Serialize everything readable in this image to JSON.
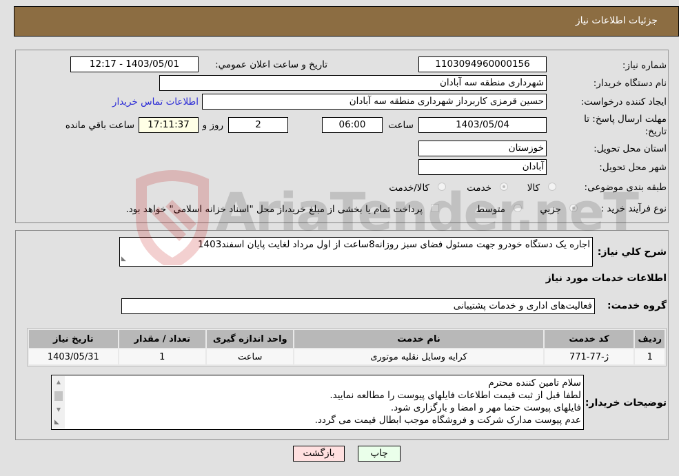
{
  "header": {
    "title": "جزئیات اطلاعات نیاز"
  },
  "form": {
    "need_number": {
      "label": "شماره نیاز:",
      "value": "1103094960000156"
    },
    "announce_datetime": {
      "label": "تاریخ و ساعت اعلان عمومي:",
      "value": "1403/05/01 - 12:17"
    },
    "buyer_org": {
      "label": "نام دستگاه خريدار:",
      "value": "شهرداری منطقه سه آبادان"
    },
    "requester": {
      "label": "ايجاد کننده درخواست:",
      "value": "حسین قرمزی کاربرداز شهرداری منطقه سه آبادان"
    },
    "buyer_contact_link": "اطلاعات تماس خريدار",
    "deadline": {
      "label_line1": "مهلت ارسال پاسخ: تا",
      "label_line2": "تاريخ:",
      "date": "1403/05/04",
      "time_label": "ساعت",
      "time": "06:00",
      "days": "2",
      "days_label": "روز و",
      "remaining": "17:11:37",
      "remaining_label": "ساعت باقي مانده"
    },
    "province": {
      "label": "استان محل تحويل:",
      "value": "خوزستان"
    },
    "city": {
      "label": "شهر محل تحويل:",
      "value": "آبادان"
    },
    "category": {
      "label": "طبقه بندی موضوعی:",
      "options": [
        "کالا",
        "خدمت",
        "کالا/خدمت"
      ],
      "selected": "خدمت"
    },
    "purchase_type": {
      "label": "نوع فرآيند خريد :",
      "options": [
        "جزيي",
        "متوسط"
      ],
      "selected": "جزيي",
      "treasury_checkbox_label": "پرداخت تمام يا بخشی از مبلغ خريد،از محل \"اسناد خزانه اسلامی\" خواهد بود."
    }
  },
  "details": {
    "summary_label": "شرح کلي نياز:",
    "summary_value": "اجاره یک دستگاه خودرو جهت مسئول فضای سبز روزانه8ساعت از اول مرداد لغایت پایان اسفند1403",
    "services_heading": "اطلاعات خدمات مورد نياز",
    "service_group_label": "گروه خدمت:",
    "service_group_value": "فعالیت‌های اداری و خدمات پشتیبانی",
    "table": {
      "headers": [
        "رديف",
        "کد خدمت",
        "نام خدمت",
        "واحد اندازه گيری",
        "تعداد / مقدار",
        "تاريخ نياز"
      ],
      "rows": [
        [
          "1",
          "ژ-77-771",
          "کرایه وسایل نقلیه موتوری",
          "ساعت",
          "1",
          "1403/05/31"
        ]
      ]
    },
    "buyer_notes_label": "توضيحات خريدار:",
    "buyer_notes_lines": [
      "سلام تامین کننده محترم",
      "لطفا قبل از ثبت قیمت اطلاعات فایلهای پیوست را مطالعه نمایید.",
      "فایلهای پیوست حتما مهر و امضا و بارگزاری شود.",
      "عدم پیوست مدارک شرکت و فروشگاه موجب ابطال قیمت می گردد."
    ]
  },
  "buttons": {
    "print": "چاپ",
    "back": "بازگشت"
  },
  "watermark": {
    "text": "AriaTender.neT"
  },
  "colors": {
    "header_bg": "#8c6d42",
    "link": "#2c2cd6",
    "print_bg": "#eaffea",
    "back_bg": "#ffe0e0",
    "remaining_bg": "#ffffe6"
  }
}
